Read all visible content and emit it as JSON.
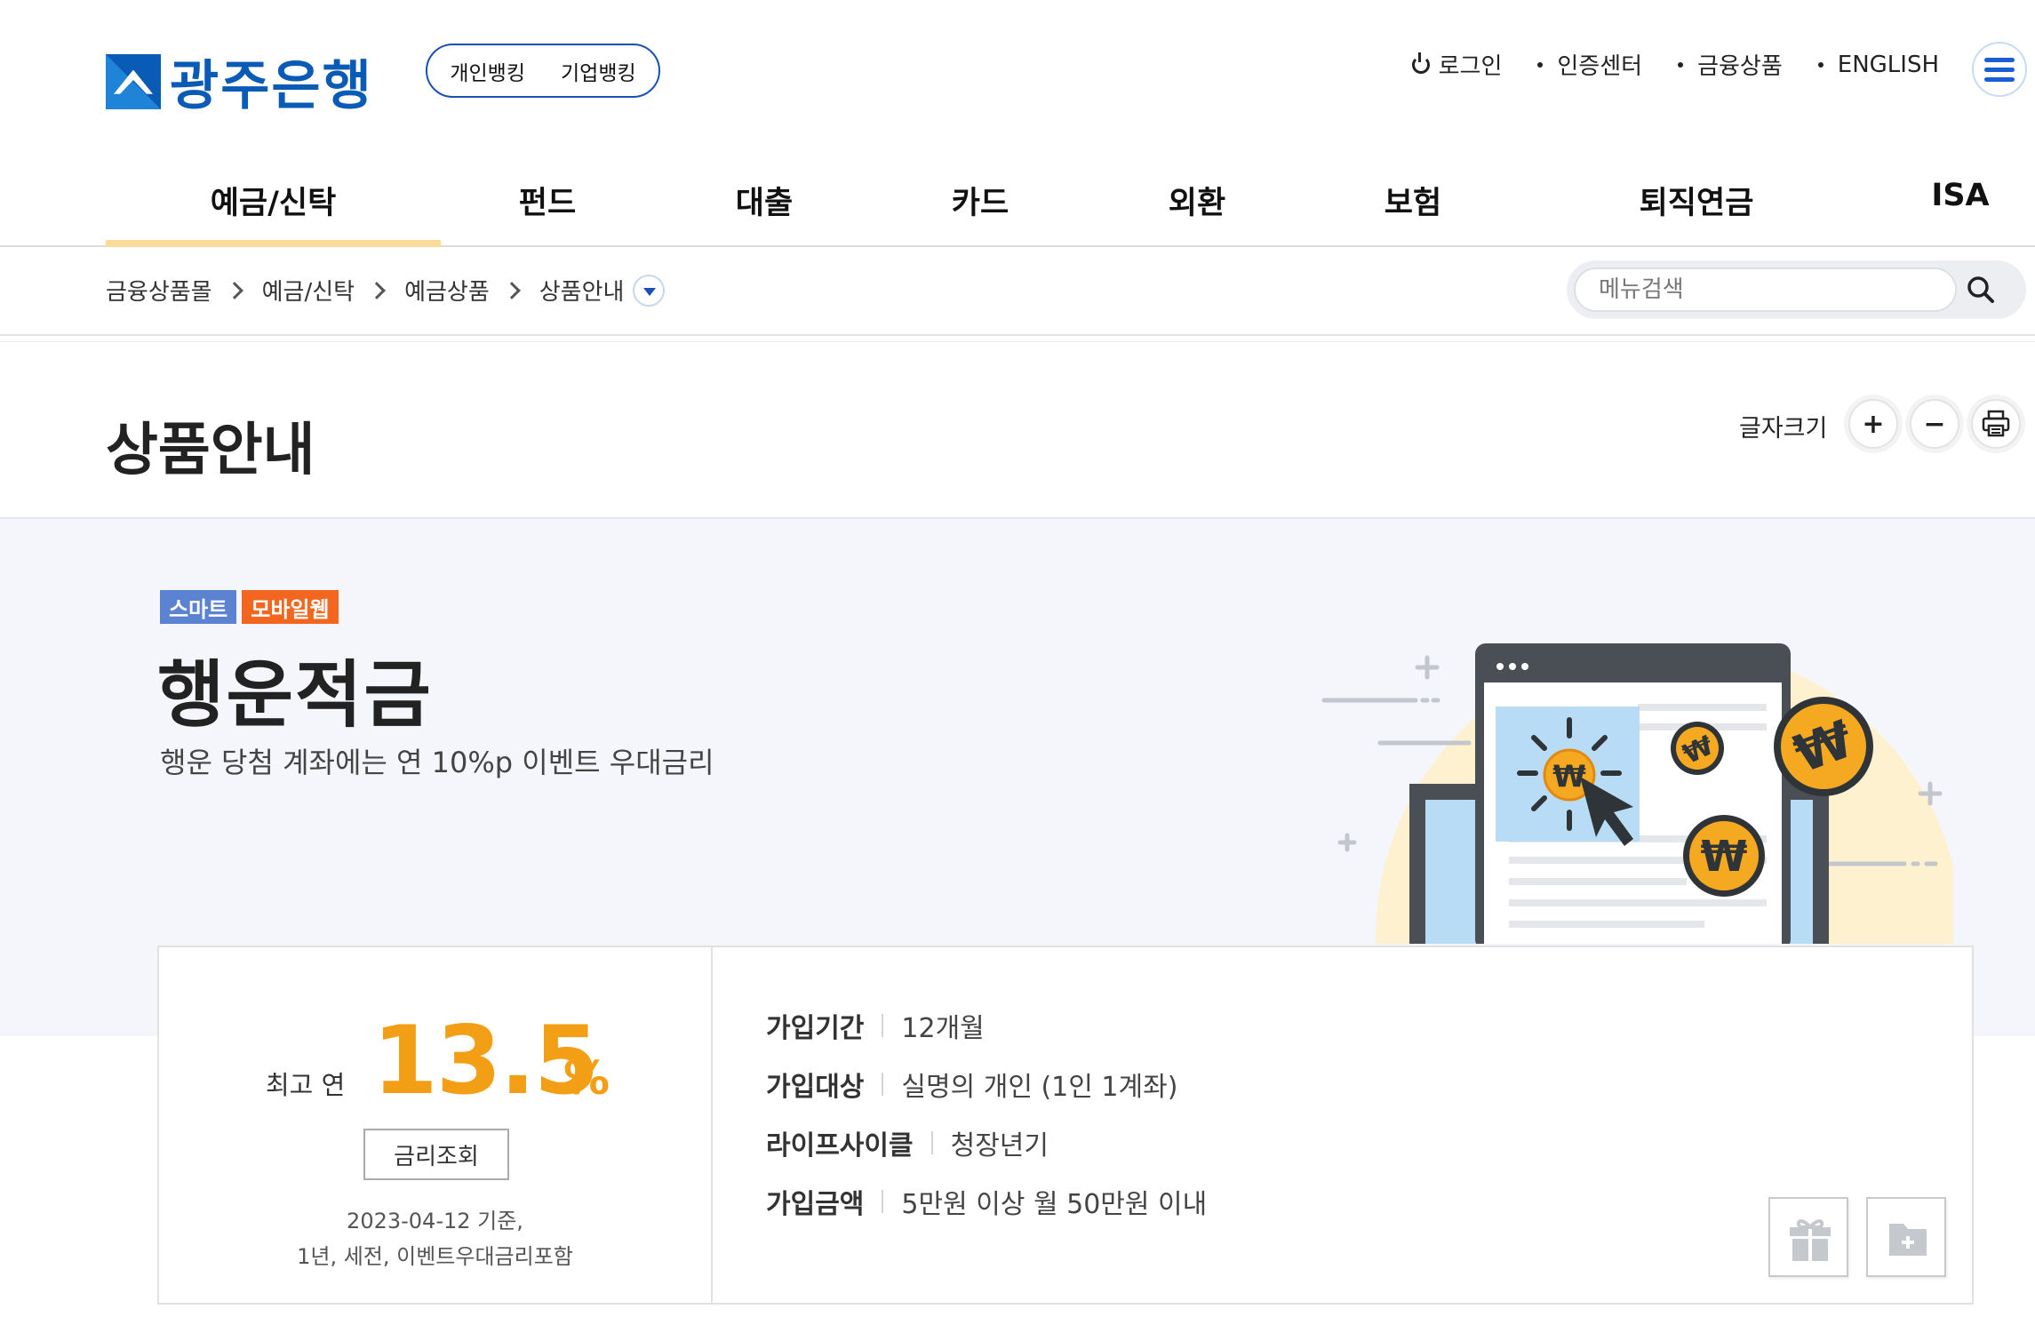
{
  "header": {
    "logo_text": "광주은행",
    "bank_tabs": [
      "개인뱅킹",
      "기업뱅킹"
    ],
    "util_links": {
      "login": "로그인",
      "cert": "인증센터",
      "products": "금융상품",
      "english": "ENGLISH"
    }
  },
  "gnb": [
    "예금/신탁",
    "펀드",
    "대출",
    "카드",
    "외환",
    "보험",
    "퇴직연금",
    "ISA"
  ],
  "breadcrumb": [
    "금융상품몰",
    "예금/신탁",
    "예금상품",
    "상품안내"
  ],
  "search": {
    "placeholder": "메뉴검색"
  },
  "page": {
    "title": "상품안내",
    "text_size_label": "글자크기",
    "plus": "+",
    "minus": "−"
  },
  "product": {
    "badges": [
      {
        "label": "스마트",
        "color": "#5b83d2"
      },
      {
        "label": "모바일웹",
        "color": "#f2661f"
      }
    ],
    "name": "행운적금",
    "description": "행운 당첨 계좌에는 연 10%p 이벤트 우대금리",
    "rate_prefix": "최고 연",
    "rate_value": "13.5",
    "rate_unit": "%",
    "rate_button": "금리조회",
    "rate_note_1": "2023-04-12 기준,",
    "rate_note_2": "1년, 세전, 이벤트우대금리포함",
    "details": [
      {
        "label": "가입기간",
        "value": "12개월"
      },
      {
        "label": "가입대상",
        "value": "실명의 개인 (1인 1계좌)"
      },
      {
        "label": "라이프사이클",
        "value": "청장년기"
      },
      {
        "label": "가입금액",
        "value": "5만원 이상 월 50만원 이내"
      }
    ],
    "coin_symbol": "₩"
  },
  "colors": {
    "brand_blue": "#0a5bb5",
    "rate_orange": "#f39f15",
    "gnb_active": "#fbdc9b",
    "hero_bg": "#f4f6fb"
  },
  "icons": [
    "power-icon",
    "menu-icon",
    "chevron-right-icon",
    "search-icon",
    "print-icon",
    "gift-icon",
    "folder-add-icon"
  ]
}
